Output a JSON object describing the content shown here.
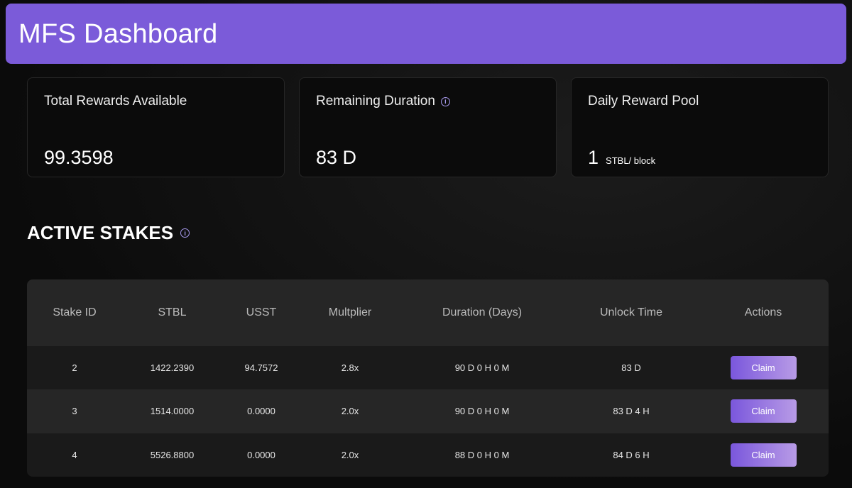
{
  "header": {
    "title": "MFS Dashboard"
  },
  "cards": [
    {
      "title": "Total Rewards Available",
      "value": "99.3598"
    },
    {
      "title": "Remaining Duration",
      "value": "83 D"
    },
    {
      "title": "Daily Reward Pool",
      "value": "1",
      "unit": "STBL/ block"
    }
  ],
  "section": {
    "title": "ACTIVE STAKES"
  },
  "table": {
    "columns": [
      "Stake ID",
      "STBL",
      "USST",
      "Multplier",
      "Duration (Days)",
      "Unlock Time",
      "Actions"
    ],
    "rows": [
      [
        "2",
        "1422.2390",
        "94.7572",
        "2.8x",
        "90 D 0 H 0 M",
        "83 D",
        "Claim"
      ],
      [
        "3",
        "1514.0000",
        "0.0000",
        "2.0x",
        "90 D 0 H 0 M",
        "83 D 4 H",
        "Claim"
      ],
      [
        "4",
        "5526.8800",
        "0.0000",
        "2.0x",
        "88 D 0 H 0 M",
        "84 D 6 H",
        "Claim"
      ]
    ]
  }
}
